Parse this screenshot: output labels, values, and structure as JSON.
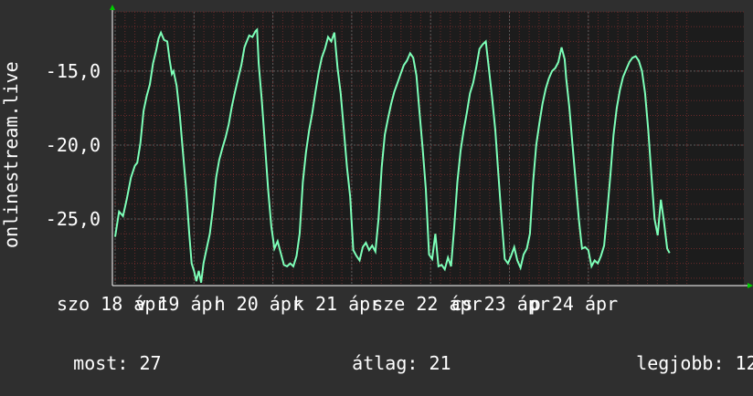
{
  "chart_data": {
    "type": "line",
    "ylabel": "onlinestream.live",
    "ylim": [
      -29.5,
      -11.0
    ],
    "y_ticks": [
      {
        "value": -15.0,
        "label": "-15,0"
      },
      {
        "value": -20.0,
        "label": "-20,0"
      },
      {
        "value": -25.0,
        "label": "-25,0"
      }
    ],
    "x_labels": [
      {
        "day": 0,
        "label": "szo 18 ápr"
      },
      {
        "day": 1,
        "label": "v 19 ápr"
      },
      {
        "day": 2,
        "label": "h 20 ápr"
      },
      {
        "day": 3,
        "label": "k 21 ápr"
      },
      {
        "day": 4,
        "label": "sze 22 ápr"
      },
      {
        "day": 5,
        "label": "cs 23 ápr"
      },
      {
        "day": 6,
        "label": "p 24 ápr"
      }
    ],
    "x_range_days": [
      0,
      7.3
    ],
    "grid": true,
    "colors": {
      "background": "#2f2f2f",
      "plot_background": "#1c1c1c",
      "line": "#7dffb8",
      "grid_major": "#5a5a5a",
      "grid_minor": "#6a2a2a",
      "axis_arrow": "#00cc00"
    },
    "series": [
      {
        "points": [
          [
            0.0,
            -26.2
          ],
          [
            0.05,
            -24.5
          ],
          [
            0.1,
            -24.8
          ],
          [
            0.15,
            -23.6
          ],
          [
            0.2,
            -22.2
          ],
          [
            0.25,
            -21.4
          ],
          [
            0.28,
            -21.2
          ],
          [
            0.32,
            -19.9
          ],
          [
            0.36,
            -17.7
          ],
          [
            0.4,
            -16.7
          ],
          [
            0.44,
            -15.9
          ],
          [
            0.48,
            -14.5
          ],
          [
            0.52,
            -13.6
          ],
          [
            0.55,
            -12.8
          ],
          [
            0.58,
            -12.4
          ],
          [
            0.62,
            -12.9
          ],
          [
            0.66,
            -13.0
          ],
          [
            0.69,
            -14.2
          ],
          [
            0.72,
            -15.2
          ],
          [
            0.74,
            -15.0
          ],
          [
            0.78,
            -16.0
          ],
          [
            0.82,
            -18.0
          ],
          [
            0.86,
            -20.5
          ],
          [
            0.9,
            -23.0
          ],
          [
            0.94,
            -26.0
          ],
          [
            0.97,
            -28.0
          ],
          [
            1.0,
            -28.5
          ],
          [
            1.03,
            -29.2
          ],
          [
            1.06,
            -28.5
          ],
          [
            1.09,
            -29.3
          ],
          [
            1.12,
            -28.0
          ],
          [
            1.16,
            -27.0
          ],
          [
            1.2,
            -26.0
          ],
          [
            1.24,
            -24.3
          ],
          [
            1.28,
            -22.2
          ],
          [
            1.32,
            -21.0
          ],
          [
            1.36,
            -20.2
          ],
          [
            1.4,
            -19.5
          ],
          [
            1.44,
            -18.6
          ],
          [
            1.48,
            -17.4
          ],
          [
            1.52,
            -16.4
          ],
          [
            1.56,
            -15.5
          ],
          [
            1.6,
            -14.6
          ],
          [
            1.64,
            -13.4
          ],
          [
            1.66,
            -13.1
          ],
          [
            1.7,
            -12.6
          ],
          [
            1.74,
            -12.7
          ],
          [
            1.78,
            -12.3
          ],
          [
            1.8,
            -12.2
          ],
          [
            1.82,
            -14.5
          ],
          [
            1.86,
            -17.0
          ],
          [
            1.9,
            -20.0
          ],
          [
            1.94,
            -23.0
          ],
          [
            1.98,
            -25.5
          ],
          [
            2.02,
            -27.0
          ],
          [
            2.06,
            -26.5
          ],
          [
            2.1,
            -27.3
          ],
          [
            2.14,
            -28.1
          ],
          [
            2.18,
            -28.2
          ],
          [
            2.22,
            -28.0
          ],
          [
            2.26,
            -28.2
          ],
          [
            2.3,
            -27.5
          ],
          [
            2.34,
            -26.0
          ],
          [
            2.38,
            -22.5
          ],
          [
            2.42,
            -20.5
          ],
          [
            2.46,
            -19.0
          ],
          [
            2.5,
            -17.8
          ],
          [
            2.54,
            -16.4
          ],
          [
            2.58,
            -15.1
          ],
          [
            2.62,
            -14.1
          ],
          [
            2.66,
            -13.5
          ],
          [
            2.7,
            -12.7
          ],
          [
            2.74,
            -13.0
          ],
          [
            2.78,
            -12.4
          ],
          [
            2.82,
            -14.8
          ],
          [
            2.86,
            -16.5
          ],
          [
            2.9,
            -19.0
          ],
          [
            2.94,
            -21.5
          ],
          [
            2.98,
            -23.5
          ],
          [
            3.02,
            -27.1
          ],
          [
            3.06,
            -27.5
          ],
          [
            3.1,
            -27.8
          ],
          [
            3.14,
            -26.9
          ],
          [
            3.18,
            -26.6
          ],
          [
            3.22,
            -27.1
          ],
          [
            3.26,
            -26.8
          ],
          [
            3.3,
            -27.2
          ],
          [
            3.34,
            -25.0
          ],
          [
            3.38,
            -21.5
          ],
          [
            3.42,
            -19.3
          ],
          [
            3.46,
            -18.2
          ],
          [
            3.5,
            -17.2
          ],
          [
            3.54,
            -16.4
          ],
          [
            3.58,
            -15.8
          ],
          [
            3.62,
            -15.2
          ],
          [
            3.66,
            -14.6
          ],
          [
            3.7,
            -14.3
          ],
          [
            3.74,
            -13.8
          ],
          [
            3.78,
            -14.1
          ],
          [
            3.82,
            -15.3
          ],
          [
            3.86,
            -17.8
          ],
          [
            3.9,
            -20.3
          ],
          [
            3.94,
            -23.0
          ],
          [
            3.98,
            -27.4
          ],
          [
            4.02,
            -27.7
          ],
          [
            4.06,
            -26.0
          ],
          [
            4.1,
            -28.2
          ],
          [
            4.14,
            -28.1
          ],
          [
            4.18,
            -28.4
          ],
          [
            4.22,
            -27.6
          ],
          [
            4.26,
            -28.2
          ],
          [
            4.3,
            -25.5
          ],
          [
            4.34,
            -22.5
          ],
          [
            4.38,
            -20.4
          ],
          [
            4.42,
            -19.0
          ],
          [
            4.46,
            -17.8
          ],
          [
            4.5,
            -16.5
          ],
          [
            4.54,
            -15.8
          ],
          [
            4.58,
            -14.7
          ],
          [
            4.62,
            -13.5
          ],
          [
            4.66,
            -13.2
          ],
          [
            4.7,
            -13.0
          ],
          [
            4.74,
            -14.9
          ],
          [
            4.78,
            -16.8
          ],
          [
            4.82,
            -19.0
          ],
          [
            4.86,
            -22.0
          ],
          [
            4.9,
            -25.0
          ],
          [
            4.94,
            -27.7
          ],
          [
            4.98,
            -28.0
          ],
          [
            5.02,
            -27.5
          ],
          [
            5.06,
            -26.9
          ],
          [
            5.1,
            -27.8
          ],
          [
            5.14,
            -28.3
          ],
          [
            5.18,
            -27.4
          ],
          [
            5.22,
            -27.0
          ],
          [
            5.26,
            -26.0
          ],
          [
            5.3,
            -22.5
          ],
          [
            5.34,
            -20.0
          ],
          [
            5.38,
            -18.5
          ],
          [
            5.42,
            -17.2
          ],
          [
            5.46,
            -16.2
          ],
          [
            5.5,
            -15.5
          ],
          [
            5.54,
            -15.0
          ],
          [
            5.58,
            -14.8
          ],
          [
            5.62,
            -14.4
          ],
          [
            5.66,
            -13.4
          ],
          [
            5.7,
            -14.2
          ],
          [
            5.72,
            -15.5
          ],
          [
            5.76,
            -17.5
          ],
          [
            5.8,
            -20.0
          ],
          [
            5.84,
            -22.5
          ],
          [
            5.88,
            -25.0
          ],
          [
            5.92,
            -27.0
          ],
          [
            5.96,
            -26.9
          ],
          [
            6.0,
            -27.1
          ],
          [
            6.04,
            -28.2
          ],
          [
            6.08,
            -27.8
          ],
          [
            6.12,
            -28.0
          ],
          [
            6.16,
            -27.5
          ],
          [
            6.2,
            -26.8
          ],
          [
            6.24,
            -24.5
          ],
          [
            6.28,
            -22.0
          ],
          [
            6.32,
            -19.3
          ],
          [
            6.36,
            -17.5
          ],
          [
            6.4,
            -16.3
          ],
          [
            6.44,
            -15.4
          ],
          [
            6.48,
            -14.9
          ],
          [
            6.52,
            -14.4
          ],
          [
            6.56,
            -14.1
          ],
          [
            6.6,
            -14.0
          ],
          [
            6.64,
            -14.3
          ],
          [
            6.68,
            -15.0
          ],
          [
            6.72,
            -16.5
          ],
          [
            6.76,
            -19.0
          ],
          [
            6.8,
            -22.0
          ],
          [
            6.84,
            -25.0
          ],
          [
            6.88,
            -26.1
          ],
          [
            6.92,
            -23.7
          ],
          [
            6.96,
            -25.2
          ],
          [
            7.0,
            -27.0
          ],
          [
            7.03,
            -27.3
          ]
        ]
      }
    ]
  },
  "footer": {
    "current_label": "most:",
    "current_value": "27",
    "average_label": "átlag:",
    "average_value": "21",
    "best_label": "legjobb:",
    "best_value": "12"
  }
}
